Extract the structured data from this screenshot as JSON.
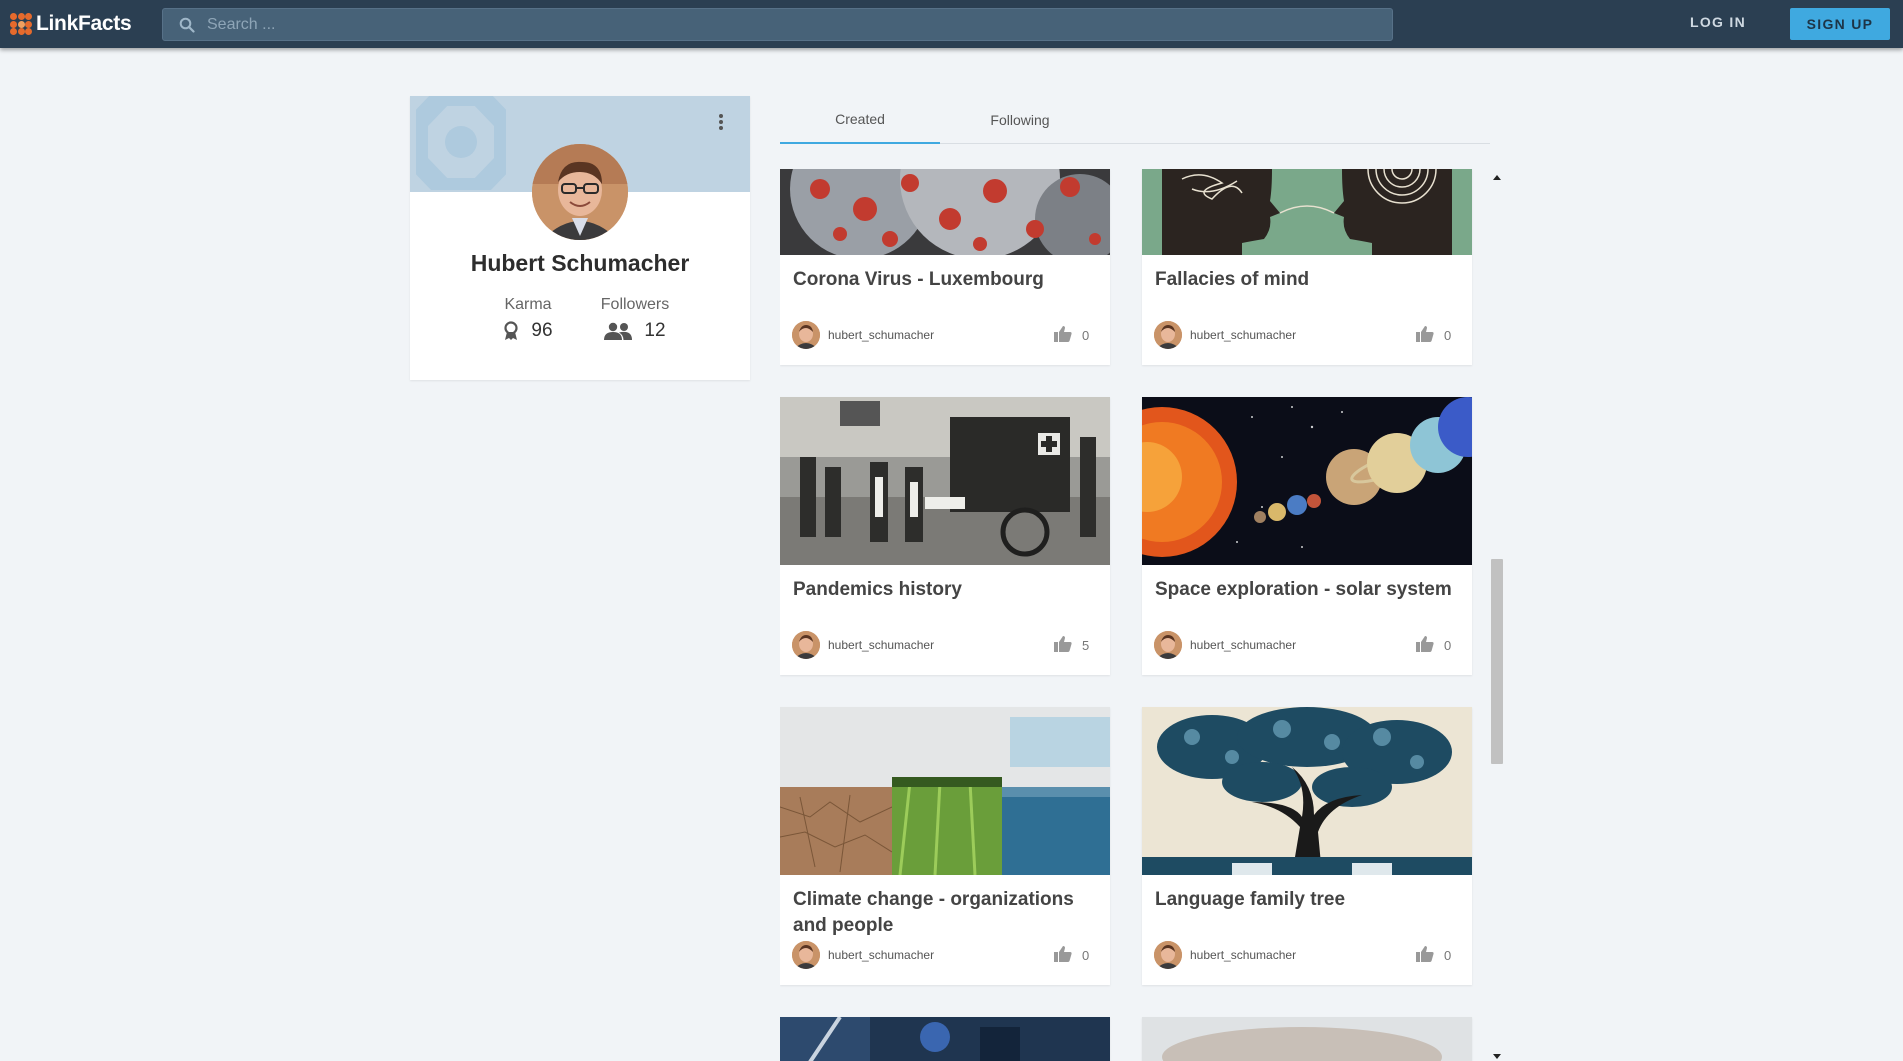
{
  "app": {
    "name": "LinkFacts"
  },
  "header": {
    "search_placeholder": "Search ...",
    "login_label": "LOG IN",
    "signup_label": "SIGN UP"
  },
  "profile": {
    "name": "Hubert Schumacher",
    "karma_label": "Karma",
    "karma_value": "96",
    "followers_label": "Followers",
    "followers_value": "12"
  },
  "tabs": [
    {
      "label": "Created",
      "active": true
    },
    {
      "label": "Following",
      "active": false
    }
  ],
  "cards": [
    {
      "title": "Corona Virus - Luxembourg",
      "user": "hubert_schumacher",
      "likes": "0",
      "image": "coronavirus"
    },
    {
      "title": "Fallacies of mind",
      "user": "hubert_schumacher",
      "likes": "0",
      "image": "heads-illustration"
    },
    {
      "title": "Pandemics history",
      "user": "hubert_schumacher",
      "likes": "5",
      "image": "historic-ambulance-photo"
    },
    {
      "title": "Space exploration - solar system",
      "user": "hubert_schumacher",
      "likes": "0",
      "image": "solar-system"
    },
    {
      "title": "Climate change - organizations and people",
      "user": "hubert_schumacher",
      "likes": "0",
      "image": "climate-landscape"
    },
    {
      "title": "Language family tree",
      "user": "hubert_schumacher",
      "likes": "0",
      "image": "language-tree"
    }
  ],
  "colors": {
    "topbar": "#2b3f52",
    "accent": "#3fa9e0",
    "logo": "#e66a2c",
    "page_bg": "#f1f4f7"
  },
  "icons": [
    "search-icon",
    "kebab-menu-icon",
    "karma-medal-icon",
    "followers-icon",
    "thumb-up-icon"
  ]
}
